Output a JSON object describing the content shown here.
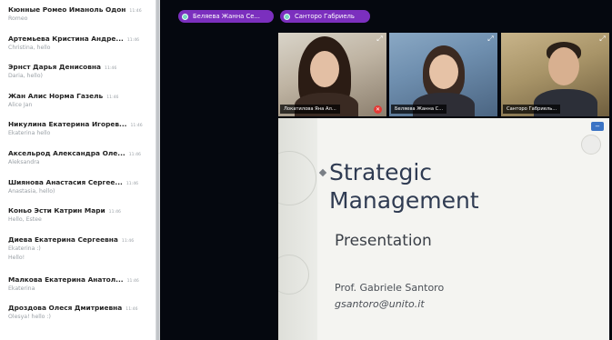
{
  "chat": {
    "messages": [
      {
        "name": "Кюнные Ромео Иманоль Одон",
        "time": "11:46",
        "text": "Romeo"
      },
      {
        "name": "Артемьева Кристина Андре...",
        "time": "11:46",
        "text": "Christina, hello"
      },
      {
        "name": "Эрнст Дарья Денисовна",
        "time": "11:46",
        "text": "Daria, hello)"
      },
      {
        "name": "Жан Алис Норма Газель",
        "time": "11:46",
        "text": "Alice Jan"
      },
      {
        "name": "Никулина Екатерина Игорев...",
        "time": "11:46",
        "text": "Ekaterina hello"
      },
      {
        "name": "Аксельрод Александра Оле...",
        "time": "11:46",
        "text": "Aleksandra"
      },
      {
        "name": "Шиянова Анастасия Сергее...",
        "time": "11:46",
        "text": "Anastasia, hello)"
      },
      {
        "name": "Коньо Эсти Катрин Мари",
        "time": "11:46",
        "text": "Hello, Estee"
      },
      {
        "name": "Диева Екатерина Сергеевна",
        "time": "11:46",
        "text": "Ekaterina :)",
        "text2": "Hello!"
      },
      {
        "name": "Малкова Екатерина Анатол...",
        "time": "11:46",
        "text": "Ekaterina"
      },
      {
        "name": "Дроздова Олеся Дмитриевна",
        "time": "11:46",
        "text": "Olesya! hello :)"
      }
    ]
  },
  "speakers": {
    "pill_1": "Беляева Жанна Се...",
    "pill_2": "Санторо Габриель"
  },
  "tiles": [
    {
      "label": "Локатилова Яна Ал...",
      "icon": "microphone-off-icon"
    },
    {
      "label": "Беляева Жанна С...",
      "icon": "expand-icon"
    },
    {
      "label": "Санторо Габриель...",
      "icon": "expand-icon"
    }
  ],
  "slide": {
    "title_line1": "Strategic",
    "title_line2": "Management",
    "subtitle": "Presentation",
    "author": "Prof. Gabriele Santoro",
    "email": "gsantoro@unito.it"
  },
  "colors": {
    "stage_bg": "#05080f",
    "pill_bg": "#7b2fbe",
    "slide_bg": "#f4f4f1",
    "mic_off": "#e53935"
  }
}
